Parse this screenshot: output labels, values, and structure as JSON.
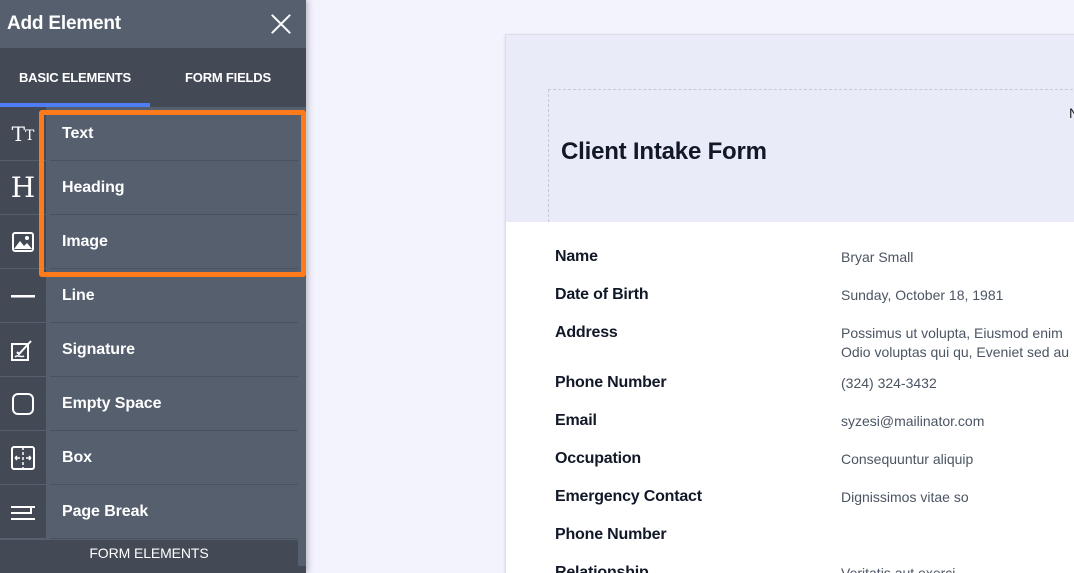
{
  "sidebar": {
    "title": "Add Element",
    "tabs": [
      {
        "label": "BASIC ELEMENTS",
        "active": true
      },
      {
        "label": "FORM FIELDS",
        "active": false
      }
    ],
    "items": [
      {
        "label": "Text",
        "icon": "text-icon"
      },
      {
        "label": "Heading",
        "icon": "heading-icon"
      },
      {
        "label": "Image",
        "icon": "image-icon"
      },
      {
        "label": "Line",
        "icon": "line-icon"
      },
      {
        "label": "Signature",
        "icon": "signature-icon"
      },
      {
        "label": "Empty Space",
        "icon": "empty-space-icon"
      },
      {
        "label": "Box",
        "icon": "box-icon"
      },
      {
        "label": "Page Break",
        "icon": "page-break-icon"
      }
    ],
    "section_label": "FORM ELEMENTS",
    "highlight_color": "#ff7a1a",
    "accent_color": "#4f7df6"
  },
  "form": {
    "title": "Client Intake Form",
    "header_partial_text": "N",
    "rows": [
      {
        "label": "Name",
        "value": "Bryar Small"
      },
      {
        "label": "Date of Birth",
        "value": "Sunday, October 18, 1981"
      },
      {
        "label": "Address",
        "value": "Possimus ut volupta, Eiusmod enim",
        "value2": "Odio voluptas qui qu, Eveniet sed au"
      },
      {
        "label": "Phone Number",
        "value": "(324) 324-3432"
      },
      {
        "label": "Email",
        "value": "syzesi@mailinator.com"
      },
      {
        "label": "Occupation",
        "value": "Consequuntur aliquip"
      },
      {
        "label": "Emergency Contact",
        "value": "Dignissimos vitae so"
      },
      {
        "label": "Phone Number",
        "value": ""
      },
      {
        "label": "Relationship",
        "value": "Veritatis aut exerci"
      }
    ]
  }
}
